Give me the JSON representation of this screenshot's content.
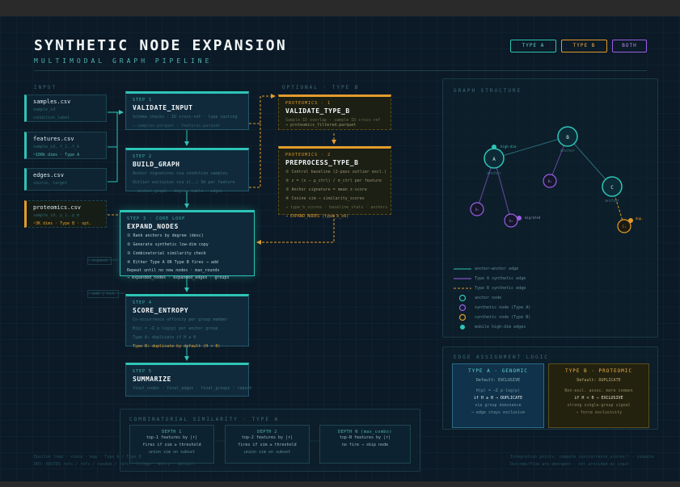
{
  "header": {
    "title": "SYNTHETIC NODE EXPANSION",
    "subtitle": "MULTIMODAL GRAPH PIPELINE",
    "badges": [
      "TYPE A",
      "TYPE B",
      "BOTH"
    ]
  },
  "sections": {
    "input": "INPUT",
    "optional": "OPTIONAL · TYPE B",
    "graph": "GRAPH STRUCTURE",
    "edge_logic": "EDGE ASSIGNMENT LOGIC",
    "combinatorial": "COMBINATORIAL SIMILARITY · TYPE A"
  },
  "inputs": [
    {
      "name": "samples.csv",
      "line1": "sample_id",
      "line2": "condition_label"
    },
    {
      "name": "features.csv",
      "line1": "sample_id, f_1..f_k",
      "line2": "~100k dims · Type A"
    },
    {
      "name": "edges.csv",
      "line1": "source, target",
      "line2": ""
    },
    {
      "name": "proteomics.csv",
      "line1": "sample_id, p_1..p_m",
      "line2": "~3K dims · Type B · opt."
    }
  ],
  "steps": {
    "s1": {
      "k": "STEP 1",
      "h": "VALIDATE_INPUT",
      "d1": "Schema checks · ID cross-ref · type casting",
      "d2": "→ samples.parquet · features.parquet"
    },
    "s2": {
      "k": "STEP 2",
      "h": "BUILD_GRAPH",
      "d1": "Anchor signatures via condition samples",
      "d2": "Outlier exclusion via z(..) 3σ per feature",
      "d3": "→ anchor_graph · degree_table · edges"
    },
    "s3": {
      "k": "STEP 3 · CORE LOOP",
      "h": "EXPAND_NODES",
      "d1": "① Rank anchors by degree (desc)",
      "d2": "② Generate synthetic low-dim copy",
      "d3": "③ Combinatorial similarity check",
      "d4": "④ Either Type A OR Type B fires → add",
      "d5": "Repeat until no new nodes · max_rounds",
      "d6": "→ expanded_nodes · expanded_edges · groups"
    },
    "s4": {
      "k": "STEP 4",
      "h": "SCORE_ENTROPY",
      "d1": "Co-occurrence affinity per group member",
      "d2": "H(p) = −Σ p·log(p) per anchor group",
      "d3": "Type A: duplicate if H ≥ θ",
      "d4": "Type B: duplicate by default (H < θ)"
    },
    "s5": {
      "k": "STEP 5",
      "h": "SUMMARIZE",
      "d1": "final_nodes · final_edges · final_groups · report"
    },
    "p1": {
      "k": "PROTEOMICS · 1",
      "h": "VALIDATE_TYPE_B",
      "d1": "Sample-ID overlap · sample ID cross-ref",
      "d2": "→ proteomics_filtered.parquet"
    },
    "p2": {
      "k": "PROTEOMICS · 2",
      "h": "PREPROCESS_TYPE_B",
      "d1": "① Control baseline (2-pass outlier excl.)",
      "d2": "② z = (x − μ_ctrl) / σ_ctrl per feature",
      "d3": "③ Anchor signature = mean z-score",
      "d4": "④ Cosine sim → similarity_scores",
      "d5": "→ type_b_scores · baseline_stats · anchors",
      "d6": "→ EXPAND_NODES (type_b_ok)"
    }
  },
  "side_tags": {
    "expand": "expand",
    "add_hit": "add | hit"
  },
  "graph": {
    "nodes": [
      {
        "id": "A",
        "label": "A",
        "sub": "anchor",
        "kind": "anchor"
      },
      {
        "id": "B",
        "label": "B",
        "sub": "anchor",
        "kind": "anchor"
      },
      {
        "id": "C",
        "label": "C",
        "sub": "anchor",
        "kind": "anchor"
      },
      {
        "id": "A1",
        "label": "A₁",
        "sub": "",
        "kind": "synth_a"
      },
      {
        "id": "A2",
        "label": "A₂",
        "sub": "",
        "kind": "synth_a"
      },
      {
        "id": "B1",
        "label": "B₁",
        "sub": "",
        "kind": "synth_a"
      },
      {
        "id": "C1",
        "label": "C₁",
        "sub": "",
        "kind": "synth_b"
      }
    ],
    "annotations": {
      "high_dim": "high-dim",
      "migrated": "migrated",
      "dup": "dup."
    }
  },
  "legend": [
    {
      "kind": "line-teal",
      "label": "anchor–anchor edge"
    },
    {
      "kind": "line-purple",
      "label": "Type A synthetic edge"
    },
    {
      "kind": "line-orange",
      "label": "Type B synthetic edge"
    },
    {
      "kind": "ring-teal",
      "label": "anchor node"
    },
    {
      "kind": "ring-purple",
      "label": "synthetic node (Type A)"
    },
    {
      "kind": "ring-orange",
      "label": "synthetic node (Type B)"
    },
    {
      "kind": "dot-teal",
      "label": "mobile high-dim edges"
    }
  ],
  "edge_logic": {
    "a": {
      "title": "TYPE A · GENOMIC",
      "l1": "Default: EXCLUSIVE",
      "l2": "H(p) = −Σ p·log(p)",
      "l3": "if H ≥ θ → DUPLICATE",
      "l4": "via group dominance",
      "l5": "→ edge stays exclusive"
    },
    "b": {
      "title": "TYPE B · PROTEOMIC",
      "l1": "Default: DUPLICATE",
      "l2": "Non-excl. assoc. more common",
      "l3": "if H < θ → EXCLUSIVE",
      "l4": "strong single-group signal",
      "l5": "→ force exclusivity"
    }
  },
  "combo": [
    {
      "t": "DEPTH 1",
      "l1": "top-1 features by |r|",
      "l2": "fires if sim ≥ threshold",
      "l3": "union sim on subset"
    },
    {
      "t": "DEPTH 2",
      "l1": "top-2 features by |r|",
      "l2": "fires if sim ≥ threshold",
      "l3": "union sim on subset"
    },
    {
      "t": "DEPTH N (max_combo)",
      "l1": "top-N features by |r|",
      "l2": "no fire → skip node",
      "l3": ""
    }
  ],
  "footer": {
    "left1": "Epsilon load · state · map · Type A / Type B",
    "left2": "DEV: BASTES refs / refs / random / refs · fringe · entry · default",
    "right1": "Integration points: compute_cooccurrence_scores() · compute",
    "right2": "Outcome/flow are emergent · not provided as input"
  },
  "colors": {
    "teal": "#2ec4b6",
    "orange": "#e39b2b",
    "purple": "#9b5de5",
    "bg": "#0b1a26"
  }
}
